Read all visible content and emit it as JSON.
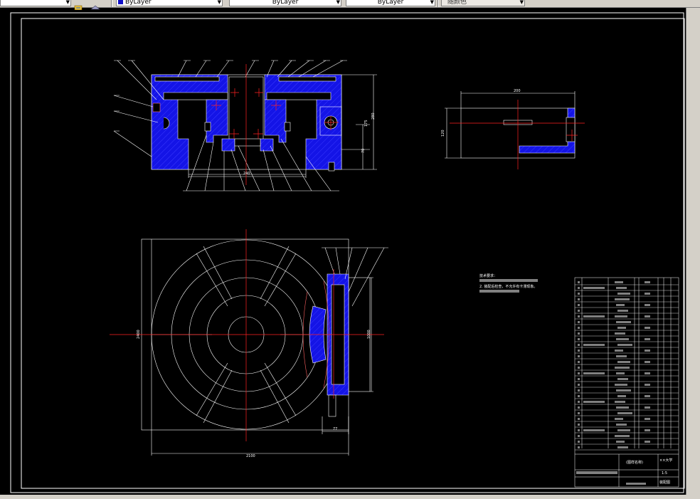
{
  "toolbar": {
    "layer_color": "ByLayer",
    "linetype": "ByLayer",
    "lineweight": "ByLayer",
    "plot_style": "随颜色"
  },
  "drawing": {
    "section_dims": {
      "top_width": "",
      "right_height": "280",
      "right_mid": "175",
      "right_low": "70",
      "bottom_inner": "240"
    },
    "side_dims": {
      "top_width": "200",
      "left_height": "120"
    },
    "plan_dims": {
      "width": "2100",
      "height": "2400",
      "small": "77",
      "port_height": "1000"
    },
    "notes": {
      "title": "技术要求：",
      "line1": "1. 装配前清洗零件。",
      "line2": "2. 装配后检查，不允许有卡滞现象。"
    },
    "title_block": {
      "drawing_name": "(图样名称)",
      "school": "××大学",
      "sheet": "装配图",
      "scale": "1:5"
    }
  }
}
